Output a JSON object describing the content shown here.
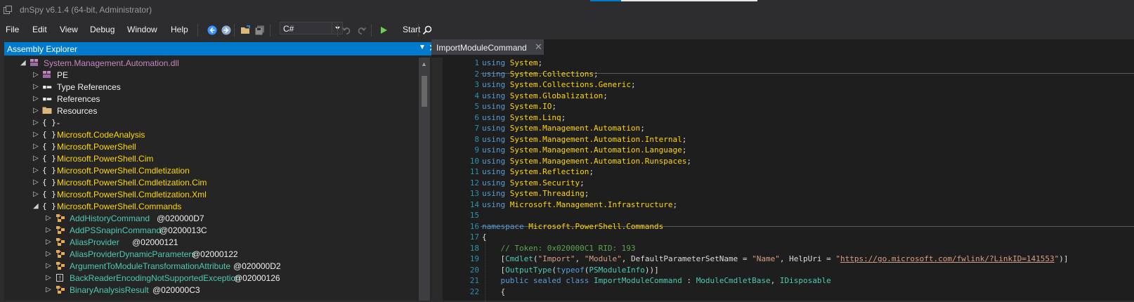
{
  "window": {
    "title": "dnSpy v6.1.4 (64-bit, Administrator)"
  },
  "menu": [
    "File",
    "Edit",
    "View",
    "Debug",
    "Window",
    "Help"
  ],
  "toolbar": {
    "language": "C#",
    "start_label": "Start"
  },
  "left_pane": {
    "title": "Assembly Explorer",
    "tree": [
      {
        "label": "System.Management.Automation.dll",
        "kind": "assembly"
      },
      {
        "label": "PE",
        "kind": "pe"
      },
      {
        "label": "Type References",
        "kind": "refs"
      },
      {
        "label": "References",
        "kind": "refs"
      },
      {
        "label": "Resources",
        "kind": "folder"
      },
      {
        "label": "-",
        "kind": "ns"
      },
      {
        "label": "Microsoft.CodeAnalysis",
        "kind": "ns"
      },
      {
        "label": "Microsoft.PowerShell",
        "kind": "ns"
      },
      {
        "label": "Microsoft.PowerShell.Cim",
        "kind": "ns"
      },
      {
        "label": "Microsoft.PowerShell.Cmdletization",
        "kind": "ns"
      },
      {
        "label": "Microsoft.PowerShell.Cmdletization.Cim",
        "kind": "ns"
      },
      {
        "label": "Microsoft.PowerShell.Cmdletization.Xml",
        "kind": "ns"
      },
      {
        "label": "Microsoft.PowerShell.Commands",
        "kind": "ns"
      },
      {
        "label": "AddHistoryCommand",
        "token": "@020000D7",
        "kind": "class"
      },
      {
        "label": "AddPSSnapinCommand",
        "token": "@0200013C",
        "kind": "class"
      },
      {
        "label": "AliasProvider",
        "token": "@02000121",
        "kind": "class"
      },
      {
        "label": "AliasProviderDynamicParameters",
        "token": "@02000122",
        "kind": "class"
      },
      {
        "label": "ArgumentToModuleTransformationAttribute",
        "token": "@020000D2",
        "kind": "class"
      },
      {
        "label": "BackReaderEncodingNotSupportedException",
        "token": "@02000126",
        "kind": "exception"
      },
      {
        "label": "BinaryAnalysisResult",
        "token": "@020000C3",
        "kind": "class"
      }
    ]
  },
  "editor": {
    "tab_label": "ImportModuleCommand",
    "lines": [
      "1",
      "2",
      "3",
      "4",
      "5",
      "6",
      "7",
      "8",
      "9",
      "10",
      "11",
      "12",
      "13",
      "14",
      "15",
      "16",
      "17",
      "18",
      "19",
      "20",
      "21",
      "22"
    ],
    "using": [
      "System",
      "System.Collections",
      "System.Collections.Generic",
      "System.Globalization",
      "System.IO",
      "System.Linq",
      "System.Management.Automation",
      "System.Management.Automation.Internal",
      "System.Management.Automation.Language",
      "System.Management.Automation.Runspaces",
      "System.Reflection",
      "System.Security",
      "System.Threading",
      "Microsoft.Management.Infrastructure"
    ],
    "namespace": "Microsoft.PowerShell.Commands",
    "token_comment": "// Token: 0x020000C1 RID: 193",
    "attr_cmdlet": "Cmdlet",
    "attr_arg1": "\"Import\"",
    "attr_arg2": "\"Module\"",
    "attr_param": "DefaultParameterSetName",
    "attr_param_val": "\"Name\"",
    "attr_help": "HelpUri",
    "attr_url": "https://go.microsoft.com/fwlink/?LinkID=141553",
    "attr_output": "OutputType",
    "typeof_kw": "typeof",
    "typeof_arg": "PSModuleInfo",
    "class_name": "ImportModuleCommand",
    "base_class": "ModuleCmdletBase",
    "iface": "IDisposable"
  }
}
